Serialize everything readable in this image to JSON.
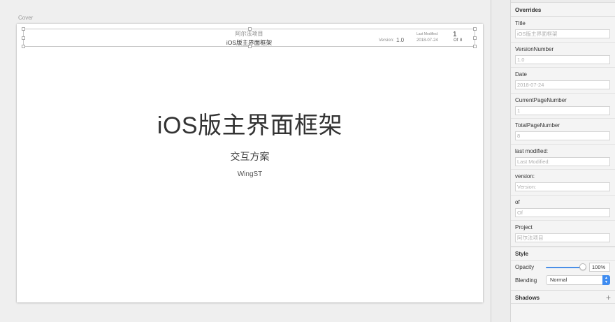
{
  "canvas": {
    "artboard_label": "Cover",
    "header": {
      "project": "阿尔法项目",
      "title": "iOS版主界面框架",
      "version_label": "Version:",
      "version_value": "1.0",
      "last_modified_label": "Last Modified:",
      "date": "2018-07-24",
      "page": "1",
      "of": "Of",
      "total": "8"
    },
    "document": {
      "title": "iOS版主界面框架",
      "subtitle": "交互方案",
      "author": "WingST"
    }
  },
  "inspector": {
    "overrides_header": "Overrides",
    "overrides": [
      {
        "label": "Title",
        "value": "iOS版主界面框架"
      },
      {
        "label": "VersionNumber",
        "value": "1.0"
      },
      {
        "label": "Date",
        "value": "2018-07-24"
      },
      {
        "label": "CurrentPageNumber",
        "value": "1"
      },
      {
        "label": "TotalPageNumber",
        "value": "8"
      },
      {
        "label": "last modified:",
        "value": "Last Modified:"
      },
      {
        "label": "version:",
        "value": "Version:"
      },
      {
        "label": "of",
        "value": "Of"
      },
      {
        "label": "Project",
        "value": "阿尔法项目"
      }
    ],
    "style_header": "Style",
    "opacity_label": "Opacity",
    "opacity_value": "100%",
    "opacity_level": 1.0,
    "blending_label": "Blending",
    "blending_value": "Normal",
    "shadows_header": "Shadows",
    "icons": {
      "add": "plus-icon",
      "select": "chevron-updown-icon"
    },
    "accent_color": "#3f8cf0"
  }
}
